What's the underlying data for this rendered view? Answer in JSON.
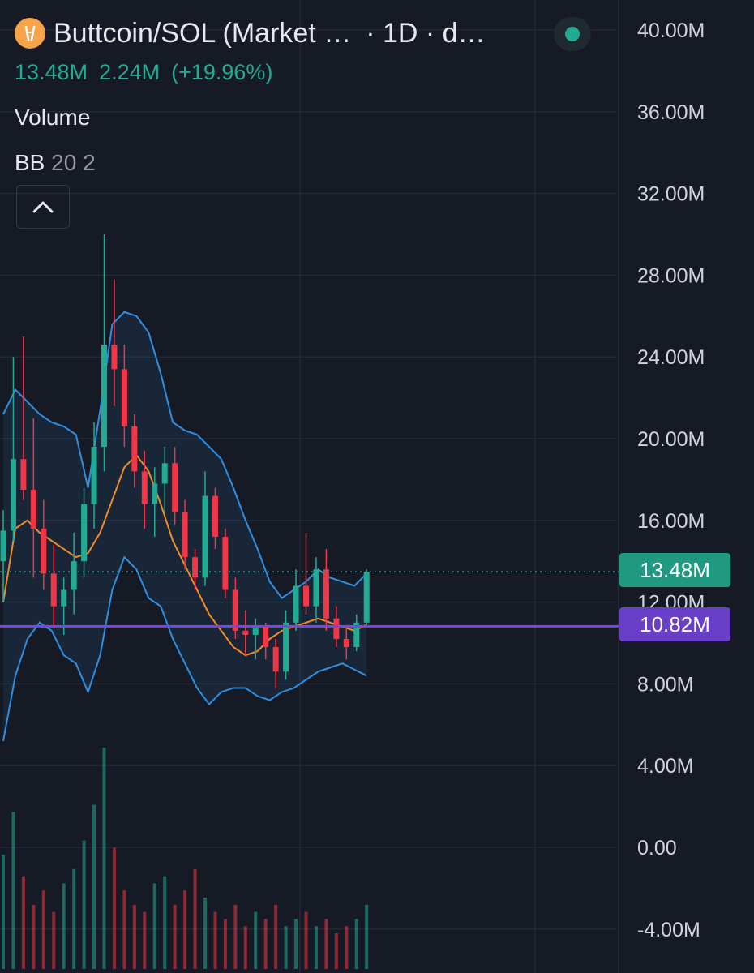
{
  "header": {
    "symbol_title": "Buttcoin/SOL (Market …",
    "interval": "· 1D · d…",
    "last_value": "13.48M",
    "change_abs": "2.24M",
    "change_pct": "(+19.96%)",
    "indicator_volume": "Volume",
    "indicator_bb_name": "BB",
    "indicator_bb_params": "20 2",
    "icons": {
      "coin": "coin-logo-icon",
      "status": "market-open-status-icon",
      "collapse": "chevron-up-icon"
    }
  },
  "price_tags": {
    "last_price": "13.48M",
    "horizontal_line": "10.82M"
  },
  "colors": {
    "background": "#161a25",
    "up": "#22ab94",
    "down": "#f23645",
    "bb_band": "#2f8fe0",
    "bb_basis": "#f08c2a",
    "horizontal_line": "#7e46e0"
  },
  "chart_data": {
    "type": "candlestick",
    "title": "Buttcoin/SOL (Market …",
    "y_axis_ticks": [
      "40.00M",
      "36.00M",
      "32.00M",
      "28.00M",
      "24.00M",
      "20.00M",
      "16.00M",
      "12.00M",
      "8.00M",
      "4.00M",
      "0.00",
      "-4.00M"
    ],
    "ylim": [
      -4,
      40
    ],
    "unit": "M",
    "last_price": 13.48,
    "horizontal_line_value": 10.82,
    "grid": true,
    "series": [
      {
        "name": "Price",
        "ohlc": [
          [
            14,
            16.5,
            12,
            15.5
          ],
          [
            15.5,
            24,
            15,
            19
          ],
          [
            19,
            25,
            17,
            17.5
          ],
          [
            17.5,
            21,
            13.2,
            15.6
          ],
          [
            15.6,
            17,
            12.6,
            13.4
          ],
          [
            13.4,
            14.8,
            10.8,
            11.8
          ],
          [
            11.8,
            13.2,
            10.4,
            12.6
          ],
          [
            12.6,
            15.4,
            11.4,
            14.0
          ],
          [
            14.0,
            17.6,
            13.2,
            16.8
          ],
          [
            16.8,
            20.8,
            15.6,
            19.6
          ],
          [
            19.6,
            30.0,
            18.4,
            24.6
          ],
          [
            24.6,
            27.8,
            21.6,
            23.4
          ],
          [
            23.4,
            24.6,
            19.6,
            20.6
          ],
          [
            20.6,
            21.2,
            17.6,
            18.4
          ],
          [
            18.4,
            19.4,
            15.6,
            16.8
          ],
          [
            16.8,
            18.6,
            15.2,
            17.8
          ],
          [
            17.8,
            19.6,
            16.4,
            18.8
          ],
          [
            18.8,
            19.6,
            15.8,
            16.4
          ],
          [
            16.4,
            17.0,
            13.6,
            14.2
          ],
          [
            14.2,
            14.6,
            12.6,
            13.2
          ],
          [
            13.2,
            18.4,
            12.8,
            17.2
          ],
          [
            17.2,
            17.6,
            14.6,
            15.2
          ],
          [
            15.2,
            15.6,
            12.2,
            12.6
          ],
          [
            12.6,
            13.2,
            10.2,
            10.6
          ],
          [
            10.6,
            11.6,
            9.4,
            10.4
          ],
          [
            10.4,
            11.2,
            9.2,
            10.8
          ],
          [
            10.8,
            11.0,
            9.2,
            9.8
          ],
          [
            9.8,
            10.2,
            7.8,
            8.6
          ],
          [
            8.6,
            11.6,
            8.2,
            11.0
          ],
          [
            11.0,
            13.6,
            10.6,
            12.8
          ],
          [
            12.8,
            15.4,
            11.4,
            11.8
          ],
          [
            11.8,
            14.2,
            11.0,
            13.6
          ],
          [
            13.6,
            14.6,
            10.6,
            11.2
          ],
          [
            11.2,
            11.8,
            9.8,
            10.2
          ],
          [
            10.2,
            10.8,
            9.2,
            9.8
          ],
          [
            9.8,
            11.4,
            9.6,
            11.0
          ],
          [
            11.0,
            13.6,
            10.8,
            13.48
          ]
        ]
      },
      {
        "name": "BB upper",
        "values": [
          21.2,
          22.4,
          21.8,
          21.2,
          20.8,
          20.6,
          20.2,
          17.6,
          21.4,
          25.6,
          26.2,
          26.0,
          25.2,
          23.2,
          20.8,
          20.4,
          20.2,
          19.6,
          19.0,
          17.6,
          16.0,
          14.6,
          13.0,
          12.2,
          12.6,
          13.0,
          13.6,
          13.2,
          13.0,
          12.8,
          13.4
        ]
      },
      {
        "name": "BB basis",
        "values": [
          12.0,
          15.6,
          16.0,
          15.4,
          15.0,
          14.6,
          14.2,
          14.4,
          15.4,
          17.0,
          18.6,
          19.2,
          18.4,
          16.8,
          15.0,
          13.8,
          12.6,
          11.4,
          10.6,
          9.8,
          9.4,
          9.6,
          10.2,
          10.6,
          10.8,
          11.0,
          11.2,
          11.0,
          10.8,
          10.6,
          10.9
        ]
      },
      {
        "name": "BB lower",
        "values": [
          5.2,
          8.4,
          10.2,
          11.0,
          10.6,
          9.4,
          9.0,
          7.6,
          9.4,
          12.6,
          14.2,
          13.6,
          12.2,
          11.8,
          10.2,
          9.0,
          7.8,
          7.0,
          7.6,
          7.8,
          7.8,
          7.4,
          7.2,
          7.6,
          7.8,
          8.2,
          8.6,
          8.8,
          9.0,
          8.7,
          8.4
        ]
      },
      {
        "name": "Volume",
        "values": [
          3.2,
          4.4,
          2.6,
          1.8,
          2.2,
          1.6,
          2.4,
          2.8,
          3.6,
          4.6,
          6.2,
          3.4,
          2.2,
          1.8,
          1.6,
          2.4,
          2.6,
          1.8,
          2.2,
          2.8,
          2.0,
          1.6,
          1.4,
          1.8,
          1.2,
          1.6,
          1.4,
          1.8,
          1.2,
          1.4,
          1.6,
          1.2,
          1.4,
          1.0,
          1.2,
          1.4,
          1.8
        ]
      }
    ]
  }
}
